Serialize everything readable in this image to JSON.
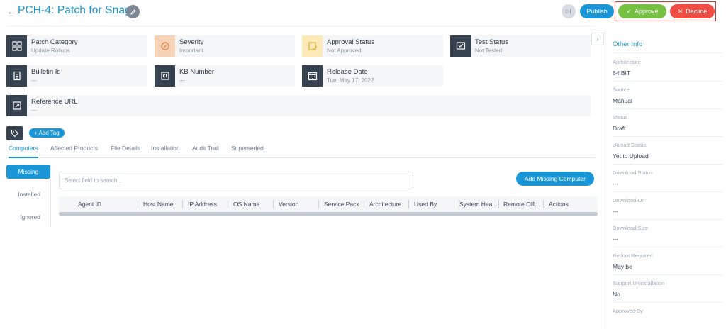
{
  "header": {
    "back_glyph": "←",
    "title": "PCH-4: Patch for Snagit",
    "skip_glyph": "▷|",
    "publish_label": "Publish",
    "approve_label": "Approve",
    "decline_label": "Decline"
  },
  "cards": [
    {
      "label": "Patch Category",
      "value": "Update Rollups",
      "icon": "grid-icon"
    },
    {
      "label": "Severity",
      "value": "Important",
      "icon": "severity-icon"
    },
    {
      "label": "Approval Status",
      "value": "Not Approved",
      "icon": "approval-icon"
    },
    {
      "label": "Test Status",
      "value": "Not Tested",
      "icon": "test-icon"
    },
    {
      "label": "Bulletin Id",
      "value": "---",
      "icon": "bulletin-icon"
    },
    {
      "label": "KB Number",
      "value": "---",
      "icon": "kb-icon"
    },
    {
      "label": "Release Date",
      "value": "Tue, May 17, 2022",
      "icon": "calendar-icon"
    },
    {
      "label": "Reference URL",
      "value": "---",
      "icon": "link-icon"
    }
  ],
  "tags": {
    "add_label": "+ Add Tag"
  },
  "tabs": [
    {
      "label": "Computers",
      "active": true
    },
    {
      "label": "Affected Products"
    },
    {
      "label": "File Details"
    },
    {
      "label": "Installation"
    },
    {
      "label": "Audit Trail"
    },
    {
      "label": "Superseded"
    }
  ],
  "subnav": [
    {
      "label": "Missing",
      "active": true
    },
    {
      "label": "Installed"
    },
    {
      "label": "Ignored"
    }
  ],
  "search": {
    "placeholder": "Select field to search..."
  },
  "add_missing_label": "Add Missing Computer",
  "table": {
    "columns": [
      "Agent ID",
      "Host Name",
      "IP Address",
      "OS Name",
      "Version",
      "Service Pack",
      "Architecture",
      "Used By",
      "System Hea...",
      "Remote Offi...",
      "Actions"
    ]
  },
  "right_panel": {
    "toggle_glyph": "›",
    "title": "Other Info",
    "fields": [
      {
        "label": "Architecture",
        "value": "64 BIT"
      },
      {
        "label": "Source",
        "value": "Manual"
      },
      {
        "label": "Status",
        "value": "Draft"
      },
      {
        "label": "Upload Status",
        "value": "Yet to Upload"
      },
      {
        "label": "Download Status",
        "value": "---"
      },
      {
        "label": "Download On",
        "value": "---"
      },
      {
        "label": "Download Size",
        "value": "---"
      },
      {
        "label": "Reboot Required",
        "value": "May be"
      },
      {
        "label": "Support Uninstallation",
        "value": "No"
      },
      {
        "label": "Approved By",
        "value": ""
      }
    ]
  },
  "colors": {
    "accent": "#1a96d7",
    "approve": "#76c043",
    "decline": "#f04d45",
    "highlight": "#e53935"
  }
}
